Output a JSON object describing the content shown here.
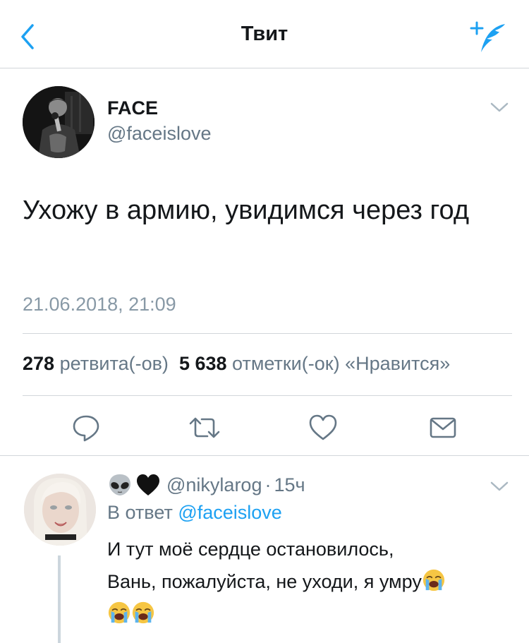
{
  "navbar": {
    "title": "Твит"
  },
  "tweet": {
    "author_name": "FACE",
    "author_handle": "@faceislove",
    "text": "Ухожу в армию, увидимся через год",
    "timestamp": "21.06.2018, 21:09",
    "retweets_count": "278",
    "retweets_label": "ретвита(-ов)",
    "likes_count": "5 638",
    "likes_label": "отметки(-ок) «Нравится»"
  },
  "reply": {
    "handle": "@nikylarog",
    "separator": "·",
    "time": "15ч",
    "reply_prefix": "В ответ",
    "reply_mention": "@faceislove",
    "text_line1": "И тут моё сердце остановилось,",
    "text_line2": "Вань, пожалуйста, не уходи, я умру"
  },
  "colors": {
    "accent": "#1da1f2",
    "text_primary": "#14171a",
    "text_secondary": "#657786",
    "divider": "#d2d6da"
  },
  "icons": {
    "back": "chevron-left-icon",
    "compose": "compose-tweet-icon",
    "menu": "chevron-down-icon",
    "reply": "reply-bubble-icon",
    "retweet": "retweet-icon",
    "like": "heart-icon",
    "share": "envelope-icon",
    "emoji_alien": "alien-emoji",
    "emoji_heart": "black-heart-emoji",
    "emoji_cry": "loudly-crying-face-emoji"
  }
}
